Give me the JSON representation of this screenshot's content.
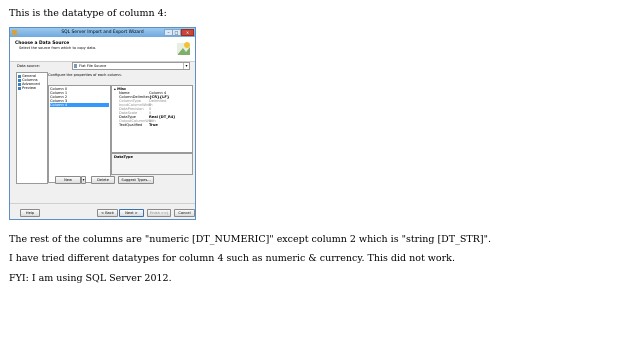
{
  "post": {
    "intro": "This is the datatype of column 4:",
    "rest": "The rest of the columns are \"numeric [DT_NUMERIC]\" except column 2 which is \"string [DT_STR]\".",
    "tried": "I have tried different datatypes for column 4 such as numeric & currency. This did not work.",
    "fyi": "FYI: I am using SQL Server 2012."
  },
  "dialog": {
    "title": "SQL Server Import and Export Wizard",
    "window_buttons": {
      "min": "–",
      "max": "□",
      "close": "×"
    },
    "header_title": "Choose a Data Source",
    "header_subtitle": "Select the source from which to copy data.",
    "data_source_label": "Data source:",
    "data_source_value": "Flat File Source",
    "nav": [
      "General",
      "Columns",
      "Advanced",
      "Preview"
    ],
    "configure_label": "Configure the properties of each column.",
    "columns": [
      "Column 0",
      "Column 1",
      "Column 2",
      "Column 3",
      "Column 4"
    ],
    "selected_column": "Column 4",
    "prop_category": "Misc",
    "properties": [
      {
        "name": "Name",
        "value": "Column 4"
      },
      {
        "name": "ColumnDelimiter",
        "value": "{CR}{LF}"
      },
      {
        "name": "ColumnType",
        "value": "Delimited"
      },
      {
        "name": "InputColumnWidth",
        "value": "0"
      },
      {
        "name": "DataPrecision",
        "value": "0"
      },
      {
        "name": "DataScale",
        "value": "0"
      },
      {
        "name": "DataType",
        "value": "Real [DT_R4]"
      },
      {
        "name": "OutputColumnWidth",
        "value": "0"
      },
      {
        "name": "TextQualified",
        "value": "True"
      }
    ],
    "description_title": "DataType",
    "buttons": {
      "new": "New",
      "new_dropdown": "▾",
      "delete": "Delete",
      "suggest": "Suggest Types...",
      "help": "Help",
      "back": "< Back",
      "next": "Next >",
      "finish": "Finish >>|",
      "cancel": "Cancel"
    }
  }
}
